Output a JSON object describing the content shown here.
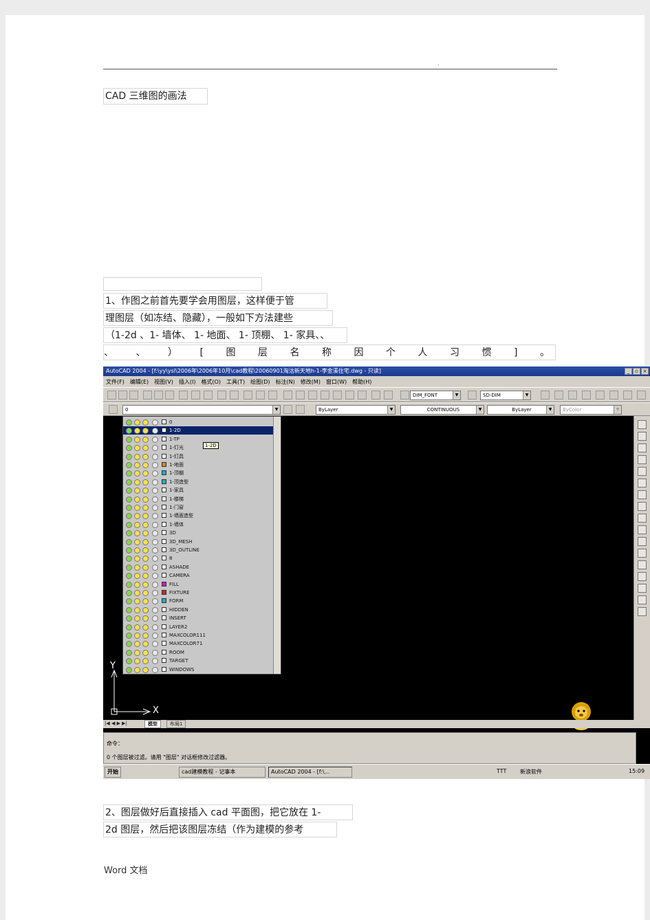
{
  "doc": {
    "heading": "CAD  三维图的画法",
    "para1_lines": [
      "1、作图之前首先要学会用图层，这样便于管",
      "理图层（如冻结、隐藏），一般如下方法建些",
      "（1-2d 、1- 墙体、 1- 地面、 1- 顶棚、 1- 家具、、"
    ],
    "para1_last_chars": [
      "、",
      "、",
      "）",
      "[",
      "图",
      "层",
      "名",
      "称",
      "因",
      "个",
      "人",
      "习",
      "惯",
      "]",
      "。"
    ],
    "para2_lines": [
      "2、图层做好后直接插入     cad 平面图，把它放在     1-",
      "2d 图层，然后把该图层冻结（作为建模的参考"
    ],
    "footer": "Word 文档"
  },
  "app": {
    "title": "AutoCAD 2004 - [f:\\yy\\ysl\\2006年\\2006年10月\\cad教程\\20060901淘沽新天地h-1-李金溪住宅.dwg - 只读]",
    "menu": [
      "文件(F)",
      "编辑(E)",
      "视图(V)",
      "插入(I)",
      "格式(O)",
      "工具(T)",
      "绘图(D)",
      "标注(N)",
      "修改(M)",
      "窗口(W)",
      "帮助(H)"
    ],
    "dimstyle": "DIM_FONT",
    "textstyle": "SD-DIM",
    "current_layer": "0",
    "color_combo": "ByLayer",
    "linetype_combo": "CONTINUOUS",
    "lineweight_combo": "ByLayer",
    "plotstyle_combo": "ByColor",
    "tooltip": "1-2D",
    "layers": [
      {
        "name": "0",
        "color": "#ffffff"
      },
      {
        "name": "1-2D",
        "color": "#ffffff",
        "selected": true
      },
      {
        "name": "1-TP",
        "color": "#ffffff"
      },
      {
        "name": "1-灯光",
        "color": "#ffffff"
      },
      {
        "name": "1-灯具",
        "color": "#ffffff"
      },
      {
        "name": "1-地面",
        "color": "#d08a20"
      },
      {
        "name": "1-顶棚",
        "color": "#20b0c0"
      },
      {
        "name": "1-顶造型",
        "color": "#20b0c0"
      },
      {
        "name": "1-家具",
        "color": "#ffffff"
      },
      {
        "name": "1-楼梯",
        "color": "#ffffff"
      },
      {
        "name": "1-门窗",
        "color": "#ffffff"
      },
      {
        "name": "1-墙面造型",
        "color": "#ffffff"
      },
      {
        "name": "1-墙体",
        "color": "#ffffff"
      },
      {
        "name": "3D",
        "color": "#ffffff"
      },
      {
        "name": "3D_MESH",
        "color": "#ffffff"
      },
      {
        "name": "3D_OUTLINE",
        "color": "#ffffff"
      },
      {
        "name": "8",
        "color": "#ffffff"
      },
      {
        "name": "ASHADE",
        "color": "#ffffff"
      },
      {
        "name": "CAMERA",
        "color": "#ffffff"
      },
      {
        "name": "FILL",
        "color": "#c020c0"
      },
      {
        "name": "FIXTURE",
        "color": "#c03020"
      },
      {
        "name": "FORM",
        "color": "#20b0c0"
      },
      {
        "name": "HIDDEN",
        "color": "#ffffff"
      },
      {
        "name": "INSERT",
        "color": "#ffffff"
      },
      {
        "name": "LAYER2",
        "color": "#ffffff"
      },
      {
        "name": "MAXCOLOR111",
        "color": "#ffffff"
      },
      {
        "name": "MAXCOLOR71",
        "color": "#ffffff"
      },
      {
        "name": "ROOM",
        "color": "#ffffff"
      },
      {
        "name": "TARGET",
        "color": "#ffffff"
      },
      {
        "name": "WINDOWS",
        "color": "#ffffff"
      }
    ],
    "axis_y": "Y",
    "axis_x": "X",
    "tabs": [
      "模型",
      "布局1"
    ],
    "cmd_prompt": "命令：",
    "cmd_history": "0 个图层被过滤。请用 \"图层\" 对话框修改过滤器。",
    "taskbar": {
      "start": "开始",
      "task1": "cad建模教程 - 记事本",
      "task2": "AutoCAD 2004 - [f:\\...",
      "tray_text1": "TTT",
      "tray_text2": "新浪软件",
      "clock": "15:09"
    }
  }
}
